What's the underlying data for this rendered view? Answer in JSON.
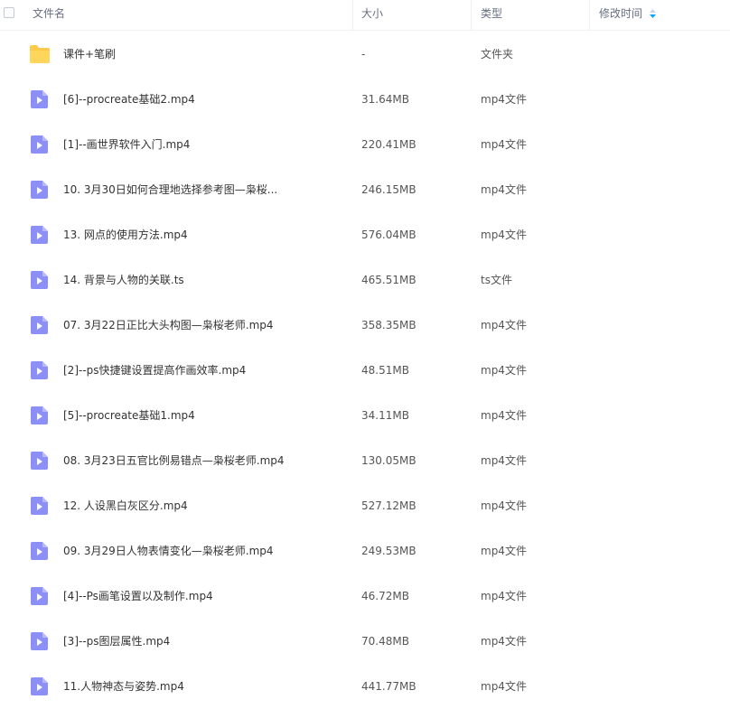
{
  "header": {
    "col_name": "文件名",
    "col_size": "大小",
    "col_type": "类型",
    "col_modified": "修改时间"
  },
  "colors": {
    "folder": "#ffc94a",
    "video_icon": "#8c8ff5",
    "sort_arrow": "#06a7ff"
  },
  "files": [
    {
      "icon": "folder-icon",
      "name": "课件+笔刷",
      "size": "-",
      "type": "文件夹"
    },
    {
      "icon": "video-icon",
      "name": "[6]--procreate基础2.mp4",
      "size": "31.64MB",
      "type": "mp4文件"
    },
    {
      "icon": "video-icon",
      "name": "[1]--画世界软件入门.mp4",
      "size": "220.41MB",
      "type": "mp4文件"
    },
    {
      "icon": "video-icon",
      "name": "10. 3月30日如何合理地选择参考图—枭桜...",
      "size": "246.15MB",
      "type": "mp4文件"
    },
    {
      "icon": "video-icon",
      "name": "13. 网点的使用方法.mp4",
      "size": "576.04MB",
      "type": "mp4文件"
    },
    {
      "icon": "video-icon",
      "name": "14. 背景与人物的关联.ts",
      "size": "465.51MB",
      "type": "ts文件"
    },
    {
      "icon": "video-icon",
      "name": "07. 3月22日正比大头构图—枭桜老师.mp4",
      "size": "358.35MB",
      "type": "mp4文件"
    },
    {
      "icon": "video-icon",
      "name": "[2]--ps快捷键设置提高作画效率.mp4",
      "size": "48.51MB",
      "type": "mp4文件"
    },
    {
      "icon": "video-icon",
      "name": "[5]--procreate基础1.mp4",
      "size": "34.11MB",
      "type": "mp4文件"
    },
    {
      "icon": "video-icon",
      "name": "08. 3月23日五官比例易错点—枭桜老师.mp4",
      "size": "130.05MB",
      "type": "mp4文件"
    },
    {
      "icon": "video-icon",
      "name": "12. 人设黑白灰区分.mp4",
      "size": "527.12MB",
      "type": "mp4文件"
    },
    {
      "icon": "video-icon",
      "name": "09. 3月29日人物表情变化—枭桜老师.mp4",
      "size": "249.53MB",
      "type": "mp4文件"
    },
    {
      "icon": "video-icon",
      "name": "[4]--Ps画笔设置以及制作.mp4",
      "size": "46.72MB",
      "type": "mp4文件"
    },
    {
      "icon": "video-icon",
      "name": "[3]--ps图层属性.mp4",
      "size": "70.48MB",
      "type": "mp4文件"
    },
    {
      "icon": "video-icon",
      "name": "11.人物神态与姿势.mp4",
      "size": "441.77MB",
      "type": "mp4文件"
    }
  ]
}
